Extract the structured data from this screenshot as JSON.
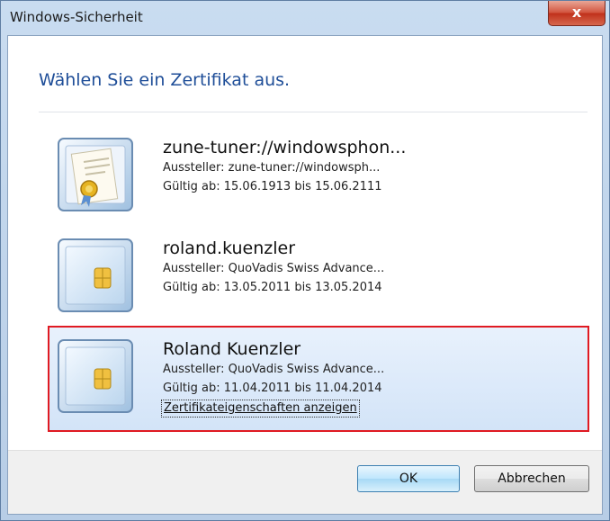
{
  "window": {
    "title": "Windows-Sicherheit",
    "close_label": "x"
  },
  "dialog": {
    "heading": "Wählen Sie ein Zertifikat aus."
  },
  "certificates": [
    {
      "name": "zune-tuner://windowsphon...",
      "issuer": "Aussteller: zune-tuner://windowsph...",
      "validity": "Gültig ab: 15.06.1913 bis 15.06.2111",
      "icon": "certificate-seal-icon"
    },
    {
      "name": "roland.kuenzler",
      "issuer": "Aussteller: QuoVadis Swiss Advance...",
      "validity": "Gültig ab: 13.05.2011 bis 13.05.2014",
      "icon": "smartcard-icon"
    },
    {
      "name": "Roland Kuenzler",
      "issuer": "Aussteller: QuoVadis Swiss Advance...",
      "validity": "Gültig ab: 11.04.2011 bis 11.04.2014",
      "icon": "smartcard-icon",
      "properties_link": "Zertifikateigenschaften anzeigen",
      "selected": true
    }
  ],
  "buttons": {
    "ok": "OK",
    "cancel": "Abbrechen"
  },
  "colors": {
    "heading": "#1f4e98",
    "selection_border": "#e01a22",
    "selection_bg": "#dbe9fa"
  }
}
